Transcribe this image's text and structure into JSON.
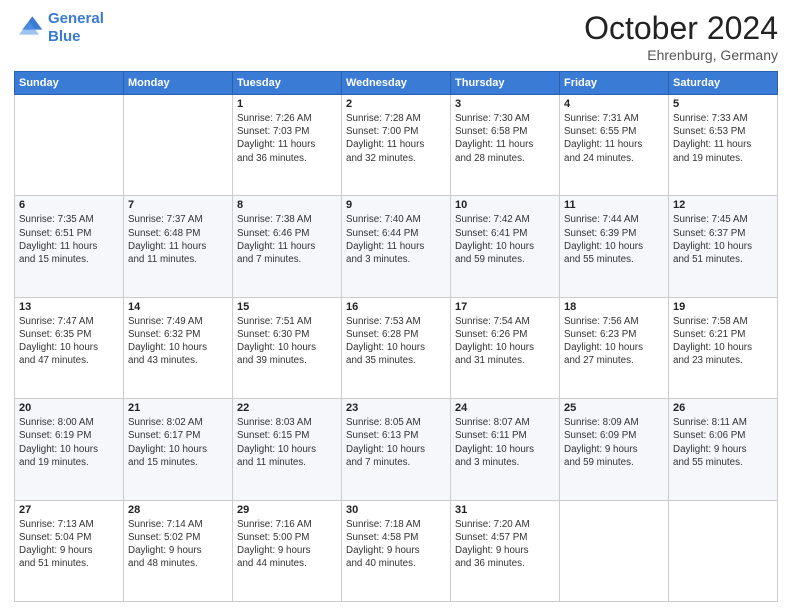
{
  "header": {
    "logo_line1": "General",
    "logo_line2": "Blue",
    "title": "October 2024",
    "subtitle": "Ehrenburg, Germany"
  },
  "days_of_week": [
    "Sunday",
    "Monday",
    "Tuesday",
    "Wednesday",
    "Thursday",
    "Friday",
    "Saturday"
  ],
  "weeks": [
    [
      {
        "day": "",
        "info": ""
      },
      {
        "day": "",
        "info": ""
      },
      {
        "day": "1",
        "info": "Sunrise: 7:26 AM\nSunset: 7:03 PM\nDaylight: 11 hours\nand 36 minutes."
      },
      {
        "day": "2",
        "info": "Sunrise: 7:28 AM\nSunset: 7:00 PM\nDaylight: 11 hours\nand 32 minutes."
      },
      {
        "day": "3",
        "info": "Sunrise: 7:30 AM\nSunset: 6:58 PM\nDaylight: 11 hours\nand 28 minutes."
      },
      {
        "day": "4",
        "info": "Sunrise: 7:31 AM\nSunset: 6:55 PM\nDaylight: 11 hours\nand 24 minutes."
      },
      {
        "day": "5",
        "info": "Sunrise: 7:33 AM\nSunset: 6:53 PM\nDaylight: 11 hours\nand 19 minutes."
      }
    ],
    [
      {
        "day": "6",
        "info": "Sunrise: 7:35 AM\nSunset: 6:51 PM\nDaylight: 11 hours\nand 15 minutes."
      },
      {
        "day": "7",
        "info": "Sunrise: 7:37 AM\nSunset: 6:48 PM\nDaylight: 11 hours\nand 11 minutes."
      },
      {
        "day": "8",
        "info": "Sunrise: 7:38 AM\nSunset: 6:46 PM\nDaylight: 11 hours\nand 7 minutes."
      },
      {
        "day": "9",
        "info": "Sunrise: 7:40 AM\nSunset: 6:44 PM\nDaylight: 11 hours\nand 3 minutes."
      },
      {
        "day": "10",
        "info": "Sunrise: 7:42 AM\nSunset: 6:41 PM\nDaylight: 10 hours\nand 59 minutes."
      },
      {
        "day": "11",
        "info": "Sunrise: 7:44 AM\nSunset: 6:39 PM\nDaylight: 10 hours\nand 55 minutes."
      },
      {
        "day": "12",
        "info": "Sunrise: 7:45 AM\nSunset: 6:37 PM\nDaylight: 10 hours\nand 51 minutes."
      }
    ],
    [
      {
        "day": "13",
        "info": "Sunrise: 7:47 AM\nSunset: 6:35 PM\nDaylight: 10 hours\nand 47 minutes."
      },
      {
        "day": "14",
        "info": "Sunrise: 7:49 AM\nSunset: 6:32 PM\nDaylight: 10 hours\nand 43 minutes."
      },
      {
        "day": "15",
        "info": "Sunrise: 7:51 AM\nSunset: 6:30 PM\nDaylight: 10 hours\nand 39 minutes."
      },
      {
        "day": "16",
        "info": "Sunrise: 7:53 AM\nSunset: 6:28 PM\nDaylight: 10 hours\nand 35 minutes."
      },
      {
        "day": "17",
        "info": "Sunrise: 7:54 AM\nSunset: 6:26 PM\nDaylight: 10 hours\nand 31 minutes."
      },
      {
        "day": "18",
        "info": "Sunrise: 7:56 AM\nSunset: 6:23 PM\nDaylight: 10 hours\nand 27 minutes."
      },
      {
        "day": "19",
        "info": "Sunrise: 7:58 AM\nSunset: 6:21 PM\nDaylight: 10 hours\nand 23 minutes."
      }
    ],
    [
      {
        "day": "20",
        "info": "Sunrise: 8:00 AM\nSunset: 6:19 PM\nDaylight: 10 hours\nand 19 minutes."
      },
      {
        "day": "21",
        "info": "Sunrise: 8:02 AM\nSunset: 6:17 PM\nDaylight: 10 hours\nand 15 minutes."
      },
      {
        "day": "22",
        "info": "Sunrise: 8:03 AM\nSunset: 6:15 PM\nDaylight: 10 hours\nand 11 minutes."
      },
      {
        "day": "23",
        "info": "Sunrise: 8:05 AM\nSunset: 6:13 PM\nDaylight: 10 hours\nand 7 minutes."
      },
      {
        "day": "24",
        "info": "Sunrise: 8:07 AM\nSunset: 6:11 PM\nDaylight: 10 hours\nand 3 minutes."
      },
      {
        "day": "25",
        "info": "Sunrise: 8:09 AM\nSunset: 6:09 PM\nDaylight: 9 hours\nand 59 minutes."
      },
      {
        "day": "26",
        "info": "Sunrise: 8:11 AM\nSunset: 6:06 PM\nDaylight: 9 hours\nand 55 minutes."
      }
    ],
    [
      {
        "day": "27",
        "info": "Sunrise: 7:13 AM\nSunset: 5:04 PM\nDaylight: 9 hours\nand 51 minutes."
      },
      {
        "day": "28",
        "info": "Sunrise: 7:14 AM\nSunset: 5:02 PM\nDaylight: 9 hours\nand 48 minutes."
      },
      {
        "day": "29",
        "info": "Sunrise: 7:16 AM\nSunset: 5:00 PM\nDaylight: 9 hours\nand 44 minutes."
      },
      {
        "day": "30",
        "info": "Sunrise: 7:18 AM\nSunset: 4:58 PM\nDaylight: 9 hours\nand 40 minutes."
      },
      {
        "day": "31",
        "info": "Sunrise: 7:20 AM\nSunset: 4:57 PM\nDaylight: 9 hours\nand 36 minutes."
      },
      {
        "day": "",
        "info": ""
      },
      {
        "day": "",
        "info": ""
      }
    ]
  ]
}
